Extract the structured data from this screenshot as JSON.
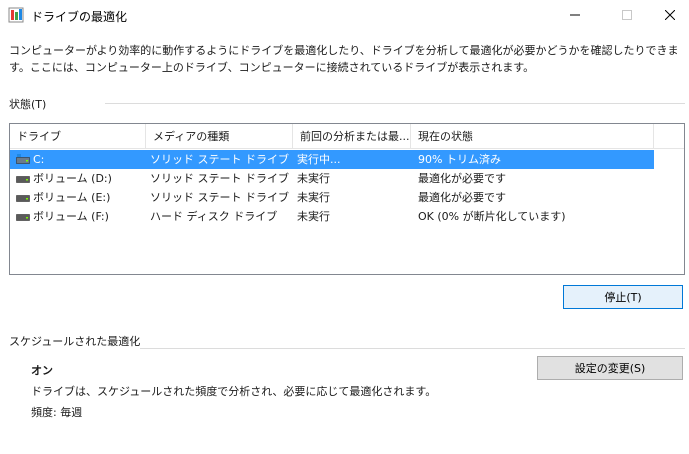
{
  "window": {
    "title": "ドライブの最適化",
    "icon": "defrag-app-icon"
  },
  "description": "コンピューターがより効率的に動作するようにドライブを最適化したり、ドライブを分析して最適化が必要かどうかを確認したりできます。ここには、コンピューター上のドライブ、コンピューターに接続されているドライブが表示されます。",
  "status_section": {
    "label": "状態(T)",
    "columns": [
      "ドライブ",
      "メディアの種類",
      "前回の分析または最...",
      "現在の状態"
    ],
    "rows": [
      {
        "drive": "C:",
        "media": "ソリッド ステート ドライブ",
        "last": "実行中...",
        "status": "90% トリム済み",
        "selected": true,
        "icon": "system-drive-icon"
      },
      {
        "drive": "ボリューム (D:)",
        "media": "ソリッド ステート ドライブ",
        "last": "未実行",
        "status": "最適化が必要です",
        "selected": false,
        "icon": "drive-icon"
      },
      {
        "drive": "ボリューム (E:)",
        "media": "ソリッド ステート ドライブ",
        "last": "未実行",
        "status": "最適化が必要です",
        "selected": false,
        "icon": "drive-icon"
      },
      {
        "drive": "ボリューム (F:)",
        "media": "ハード ディスク ドライブ",
        "last": "未実行",
        "status": "OK (0% が断片化しています)",
        "selected": false,
        "icon": "drive-icon"
      }
    ],
    "stop_button": "停止(T)"
  },
  "schedule_section": {
    "label": "スケジュールされた最適化",
    "status": "オン",
    "description": "ドライブは、スケジュールされた頻度で分析され、必要に応じて最適化されます。",
    "frequency": "頻度: 毎週",
    "change_button": "設定の変更(S)"
  },
  "colors": {
    "selection": "#3399ff",
    "primary_button_border": "#0078d7"
  }
}
